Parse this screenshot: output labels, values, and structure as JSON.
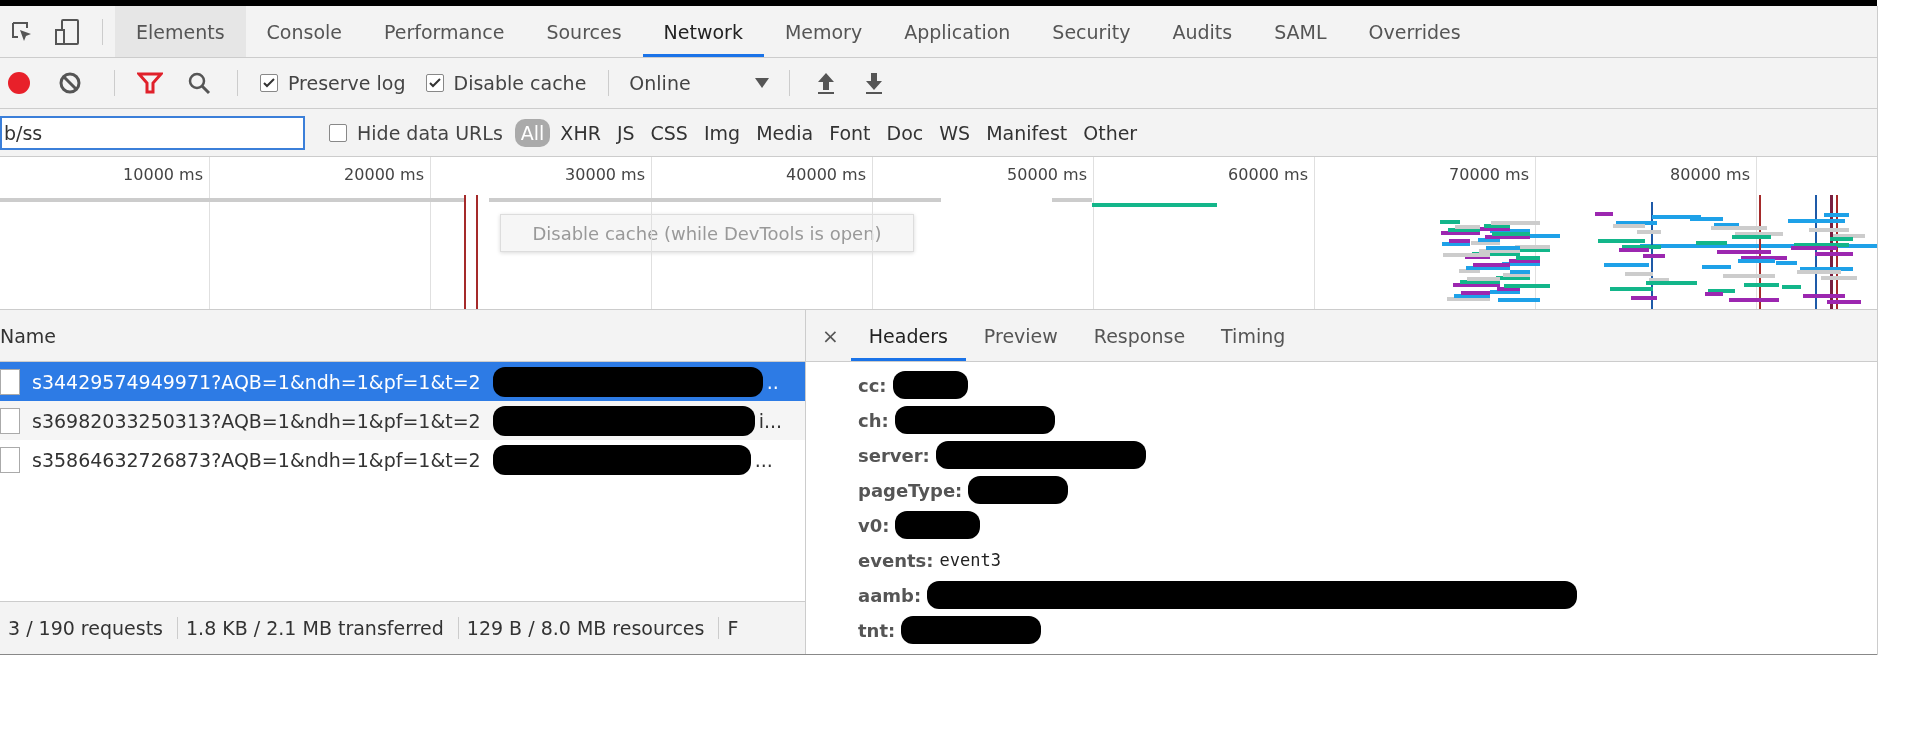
{
  "panel_tabs": [
    {
      "label": "Elements",
      "selected": false,
      "hovered": true
    },
    {
      "label": "Console",
      "selected": false,
      "hovered": false
    },
    {
      "label": "Performance",
      "selected": false,
      "hovered": false
    },
    {
      "label": "Sources",
      "selected": false,
      "hovered": false
    },
    {
      "label": "Network",
      "selected": true,
      "hovered": false
    },
    {
      "label": "Memory",
      "selected": false,
      "hovered": false
    },
    {
      "label": "Application",
      "selected": false,
      "hovered": false
    },
    {
      "label": "Security",
      "selected": false,
      "hovered": false
    },
    {
      "label": "Audits",
      "selected": false,
      "hovered": false
    },
    {
      "label": "SAML",
      "selected": false,
      "hovered": false
    },
    {
      "label": "Overrides",
      "selected": false,
      "hovered": false
    }
  ],
  "network_toolbar": {
    "recording": true,
    "preserve_log": {
      "label": "Preserve log",
      "checked": true
    },
    "disable_cache": {
      "label": "Disable cache",
      "checked": true
    },
    "throttling": "Online"
  },
  "tooltip": "Disable cache (while DevTools is open)",
  "filter": {
    "value": "b/ss",
    "hide_data_urls": {
      "label": "Hide data URLs",
      "checked": false
    },
    "types": [
      {
        "label": "All",
        "selected": true
      },
      {
        "label": "XHR",
        "selected": false
      },
      {
        "label": "JS",
        "selected": false
      },
      {
        "label": "CSS",
        "selected": false
      },
      {
        "label": "Img",
        "selected": false
      },
      {
        "label": "Media",
        "selected": false
      },
      {
        "label": "Font",
        "selected": false
      },
      {
        "label": "Doc",
        "selected": false
      },
      {
        "label": "WS",
        "selected": false
      },
      {
        "label": "Manifest",
        "selected": false
      },
      {
        "label": "Other",
        "selected": false
      }
    ]
  },
  "timeline": {
    "ticks": [
      "10000 ms",
      "20000 ms",
      "30000 ms",
      "40000 ms",
      "50000 ms",
      "60000 ms",
      "70000 ms",
      "80000 ms"
    ]
  },
  "requests": {
    "column": "Name",
    "rows": [
      {
        "name": "s34429574949971?AQB=1&ndh=1&pf=1&t=2",
        "tail": "..",
        "selected": true
      },
      {
        "name": "s36982033250313?AQB=1&ndh=1&pf=1&t=2",
        "tail": "i...",
        "selected": false
      },
      {
        "name": "s35864632726873?AQB=1&ndh=1&pf=1&t=2",
        "tail": "...",
        "selected": false
      }
    ]
  },
  "status_bar": [
    "3 / 190 requests",
    "1.8 KB / 2.1 MB transferred",
    "129 B / 8.0 MB resources",
    "F"
  ],
  "details": {
    "close": "×",
    "tabs": [
      {
        "label": "Headers",
        "selected": true
      },
      {
        "label": "Preview",
        "selected": false
      },
      {
        "label": "Response",
        "selected": false
      },
      {
        "label": "Timing",
        "selected": false
      }
    ],
    "fields": [
      {
        "key": "cc:",
        "redacted": true
      },
      {
        "key": "ch:",
        "redacted": true
      },
      {
        "key": "server:",
        "redacted": true
      },
      {
        "key": "pageType:",
        "redacted": true
      },
      {
        "key": "v0:",
        "redacted": true
      },
      {
        "key": "events:",
        "value": "event3",
        "redacted": false
      },
      {
        "key": "aamb:",
        "redacted": true
      },
      {
        "key": "tnt:",
        "redacted": true
      }
    ]
  }
}
